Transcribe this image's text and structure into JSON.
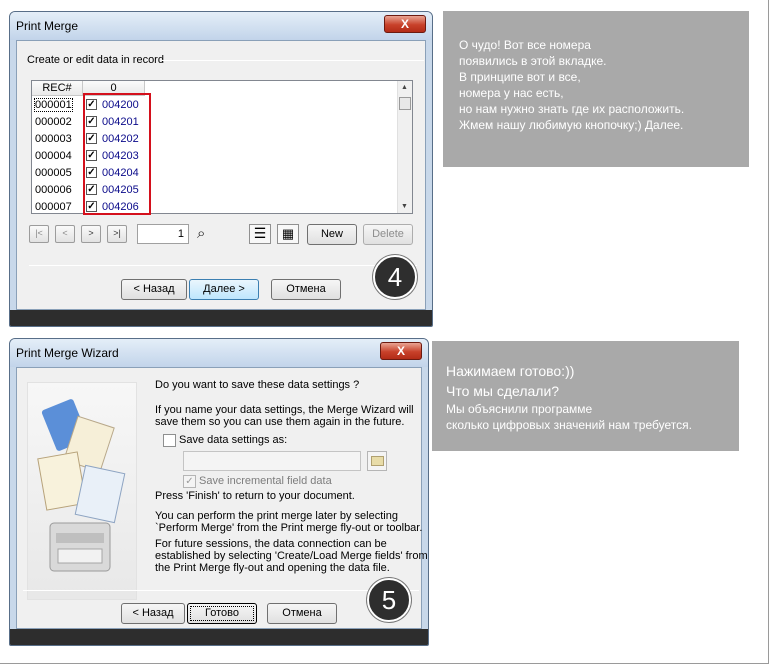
{
  "dialog1": {
    "title": "Print Merge",
    "close_label": "X",
    "group_label": "Create or edit data in record",
    "grid": {
      "headers": [
        "REC#",
        "0"
      ],
      "rows": [
        {
          "rec": "000001",
          "checked": true,
          "value": "004200"
        },
        {
          "rec": "000002",
          "checked": true,
          "value": "004201"
        },
        {
          "rec": "000003",
          "checked": true,
          "value": "004202"
        },
        {
          "rec": "000004",
          "checked": true,
          "value": "004203"
        },
        {
          "rec": "000005",
          "checked": true,
          "value": "004204"
        },
        {
          "rec": "000006",
          "checked": true,
          "value": "004205"
        },
        {
          "rec": "000007",
          "checked": true,
          "value": "004206"
        }
      ]
    },
    "record_number": "1",
    "new_label": "New",
    "delete_label": "Delete",
    "back_label": "< Назад",
    "next_label": "Далее >",
    "cancel_label": "Отмена",
    "step": "4",
    "highlight_color": "#d4101c"
  },
  "note1": {
    "lines": [
      "О чудо! Вот все номера",
      "появились в этой вкладке.",
      "В принципе вот и все,",
      "номера у нас есть,",
      "но нам нужно знать где их расположить.",
      "Жмем нашу любимую кнопочку;) Далее."
    ]
  },
  "dialog2": {
    "title": "Print Merge Wizard",
    "close_label": "X",
    "question": "Do you want to save these data settings ?",
    "info1_line1": "If you name your data settings, the Merge Wizard will",
    "info1_line2": "save them so you can use them again in the future.",
    "save_as_label": "Save data settings as:",
    "incremental_label": "Save incremental field data",
    "finish_text": "Press 'Finish' to return to your document.",
    "later_line1": "You can perform the print merge later by selecting",
    "later_line2": "`Perform Merge' from the Print merge fly-out or toolbar.",
    "future_line1": "For future sessions, the data connection can be",
    "future_line2": "established by selecting 'Create/Load Merge fields' from",
    "future_line3": "the Print Merge fly-out and opening the data file.",
    "back_label": "< Назад",
    "finish_label": "Готово",
    "cancel_label": "Отмена",
    "step": "5"
  },
  "note2": {
    "line1": "Нажимаем готово:))",
    "line2": "Что мы сделали?",
    "line3": "Мы объяснили программе",
    "line4": "сколько цифровых значений нам требуется."
  }
}
